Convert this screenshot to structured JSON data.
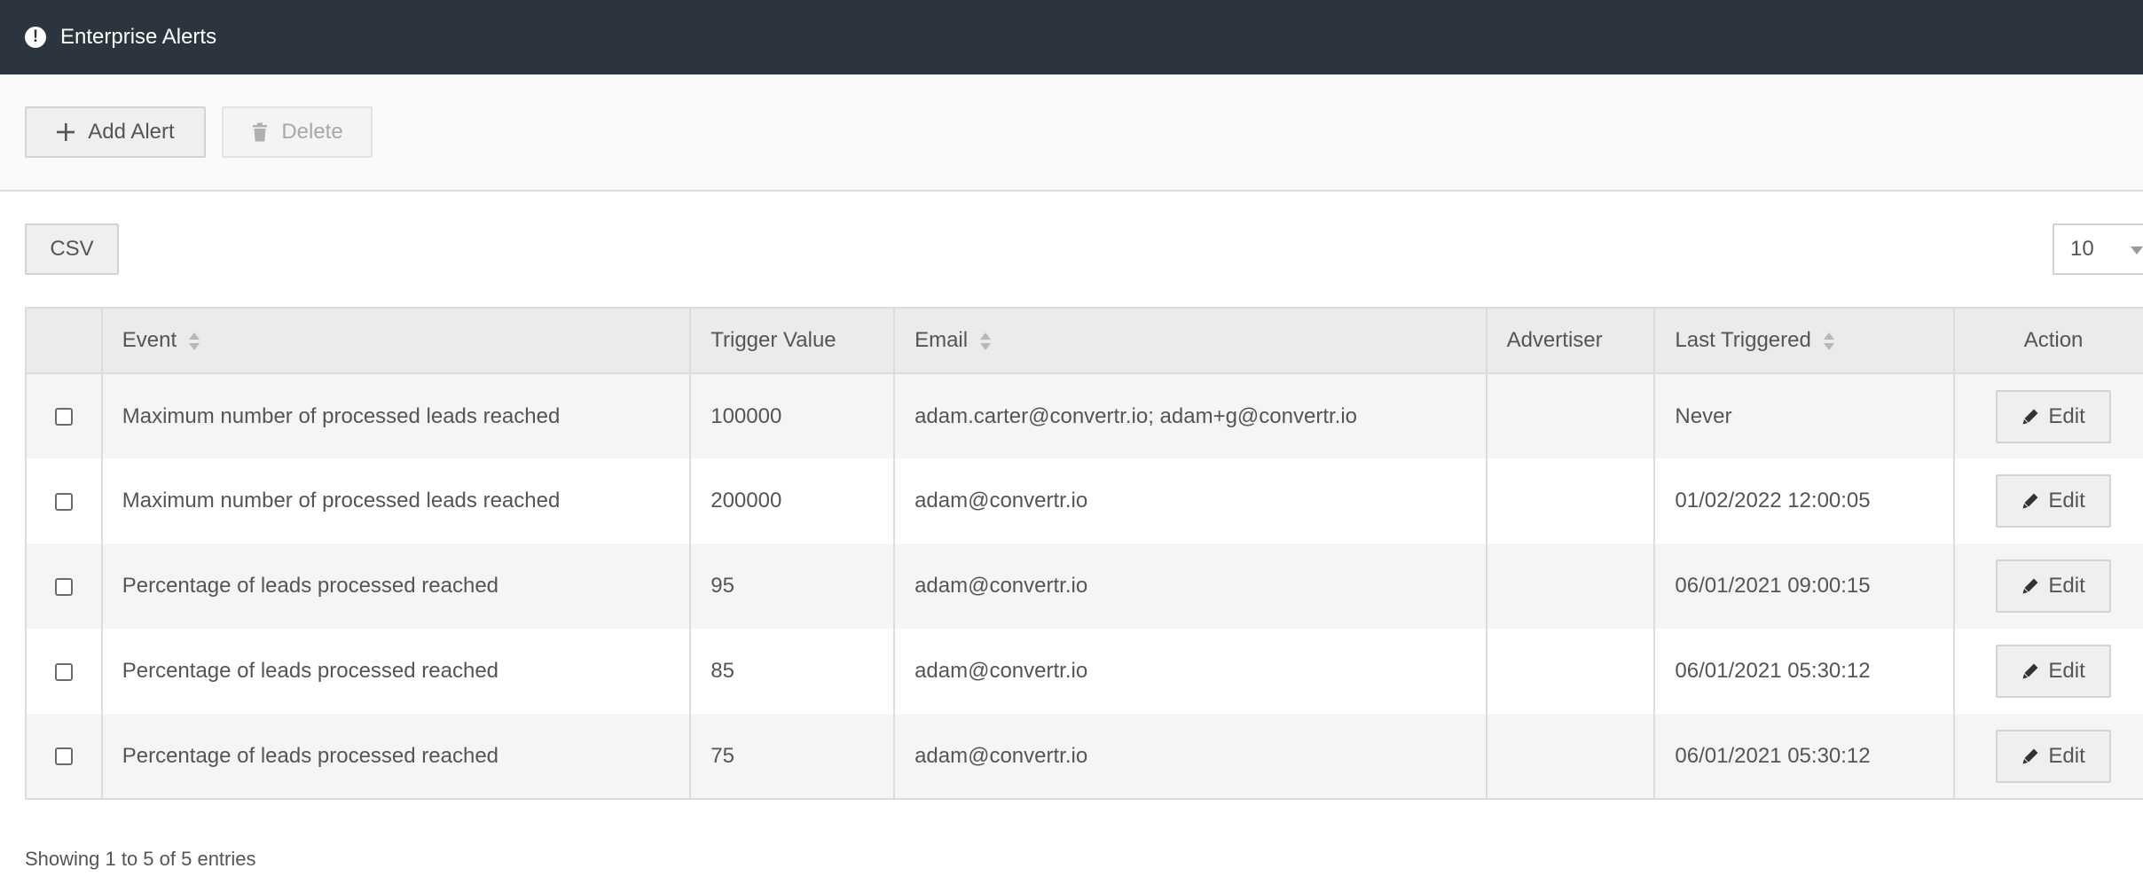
{
  "header": {
    "title": "Enterprise Alerts",
    "icon": "exclamation-circle-icon"
  },
  "toolbar": {
    "add_label": "Add Alert",
    "delete_label": "Delete"
  },
  "controls": {
    "csv_label": "CSV",
    "page_size": "10"
  },
  "table": {
    "columns": {
      "event": "Event",
      "trigger_value": "Trigger Value",
      "email": "Email",
      "advertiser": "Advertiser",
      "last_triggered": "Last Triggered",
      "action": "Action"
    },
    "rows": [
      {
        "event": "Maximum number of processed leads reached",
        "trigger_value": "100000",
        "email": "adam.carter@convertr.io; adam+g@convertr.io",
        "advertiser": "",
        "last_triggered": "Never",
        "action": "Edit"
      },
      {
        "event": "Maximum number of processed leads reached",
        "trigger_value": "200000",
        "email": "adam@convertr.io",
        "advertiser": "",
        "last_triggered": "01/02/2022 12:00:05",
        "action": "Edit"
      },
      {
        "event": "Percentage of leads processed reached",
        "trigger_value": "95",
        "email": "adam@convertr.io",
        "advertiser": "",
        "last_triggered": "06/01/2021 09:00:15",
        "action": "Edit"
      },
      {
        "event": "Percentage of leads processed reached",
        "trigger_value": "85",
        "email": "adam@convertr.io",
        "advertiser": "",
        "last_triggered": "06/01/2021 05:30:12",
        "action": "Edit"
      },
      {
        "event": "Percentage of leads processed reached",
        "trigger_value": "75",
        "email": "adam@convertr.io",
        "advertiser": "",
        "last_triggered": "06/01/2021 05:30:12",
        "action": "Edit"
      }
    ]
  },
  "footer": {
    "info": "Showing 1 to 5 of 5 entries"
  },
  "colors": {
    "header_bg": "#2c3440",
    "header_text": "#ffffff",
    "row_alt": "#f5f5f5"
  }
}
